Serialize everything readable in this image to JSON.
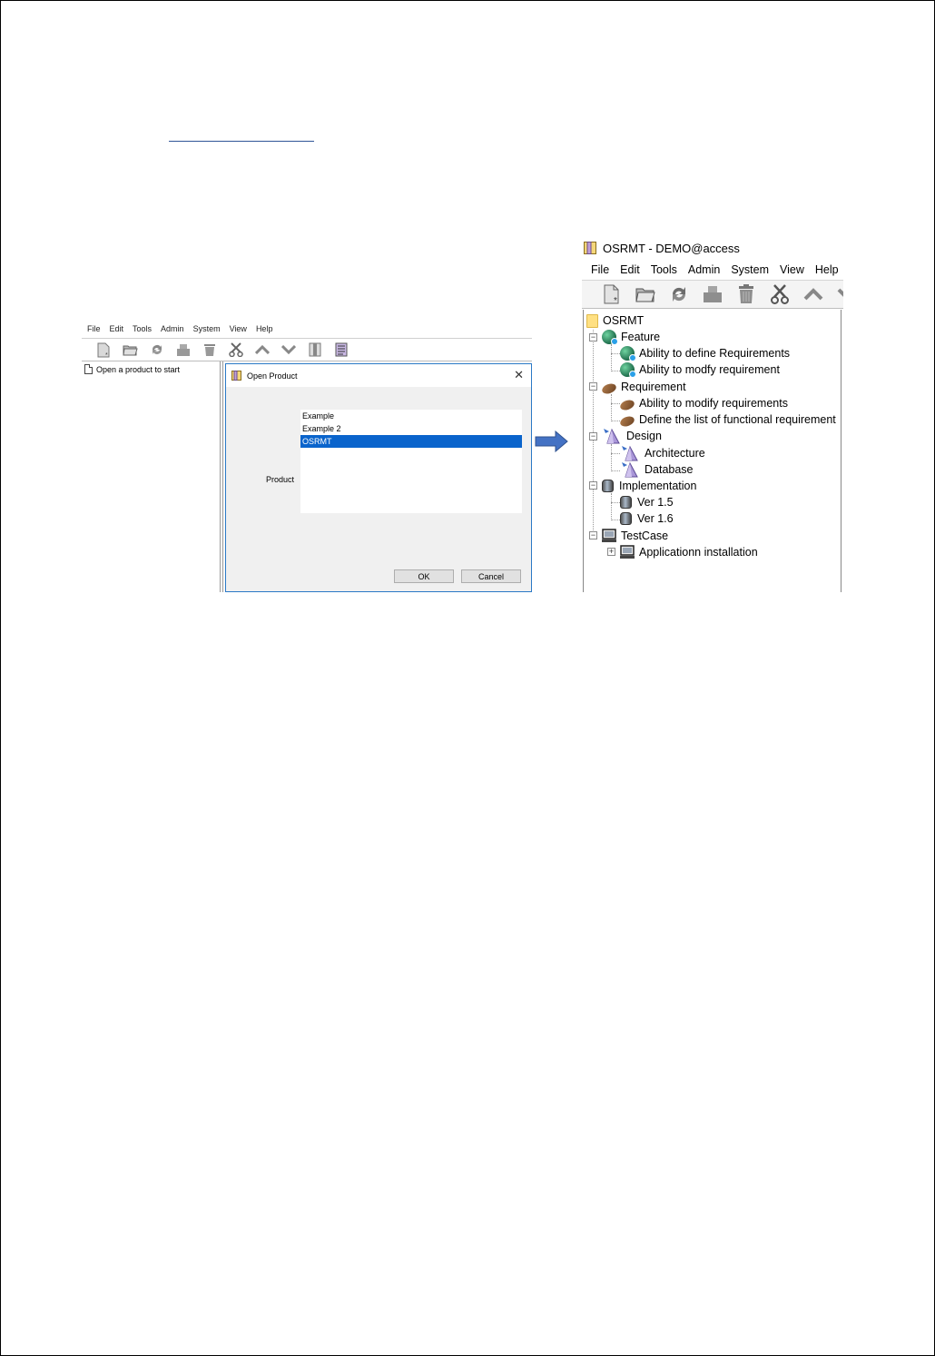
{
  "left_window": {
    "menu": [
      "File",
      "Edit",
      "Tools",
      "Admin",
      "System",
      "View",
      "Help"
    ],
    "toolbar_icons": [
      "new-icon",
      "open-icon",
      "refresh-icon",
      "print-icon",
      "delete-icon",
      "cut-icon",
      "move-up-icon",
      "move-down-icon",
      "columns-icon",
      "report-icon"
    ],
    "tree_placeholder": "Open a product to start",
    "dialog": {
      "title": "Open Product",
      "close_label": "✕",
      "product_label": "Product",
      "options": [
        "Example",
        "Example 2",
        "OSRMT"
      ],
      "selected": "OSRMT",
      "ok_label": "OK",
      "cancel_label": "Cancel"
    }
  },
  "right_window": {
    "title": "OSRMT - DEMO@access",
    "menu": [
      "File",
      "Edit",
      "Tools",
      "Admin",
      "System",
      "View",
      "Help"
    ],
    "toolbar_icons": [
      "new-icon",
      "open-icon",
      "refresh-icon",
      "print-icon",
      "delete-icon",
      "cut-icon",
      "move-up-icon"
    ],
    "tree": {
      "root": "OSRMT",
      "feature": {
        "label": "Feature",
        "children": [
          "Ability to define Requirements",
          "Ability to modfy requirement"
        ]
      },
      "requirement": {
        "label": "Requirement",
        "children": [
          "Ability to modify requirements",
          "Define the list of functional requirement"
        ]
      },
      "design": {
        "label": "Design",
        "children": [
          "Architecture",
          "Database"
        ]
      },
      "implementation": {
        "label": "Implementation",
        "children": [
          "Ver 1.5",
          "Ver 1.6"
        ]
      },
      "testcase": {
        "label": "TestCase",
        "children": [
          "Applicationn installation"
        ]
      }
    }
  },
  "colors": {
    "selection": "#0a64cc",
    "arrow": "#4472c4",
    "dialog_border": "#2b79c6"
  }
}
